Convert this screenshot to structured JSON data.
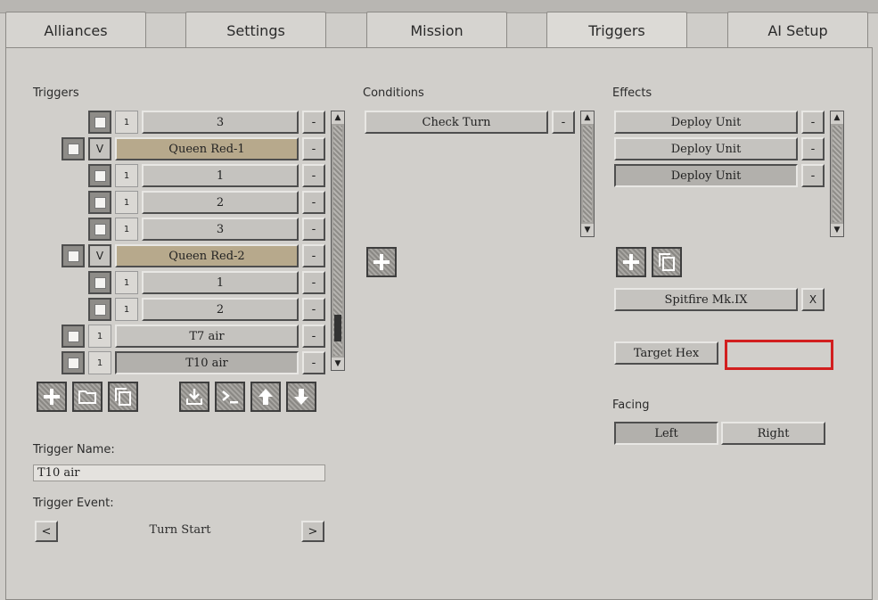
{
  "tabs": [
    "Alliances",
    "Settings",
    "Mission",
    "Triggers",
    "AI Setup"
  ],
  "active_tab": "Triggers",
  "triggers": {
    "heading": "Triggers",
    "rows": [
      {
        "num": "1",
        "label": "3",
        "has_v": false,
        "tan": false
      },
      {
        "num": "V",
        "label": "Queen Red-1",
        "has_v": true,
        "tan": true
      },
      {
        "num": "1",
        "label": "1",
        "has_v": false,
        "tan": false
      },
      {
        "num": "1",
        "label": "2",
        "has_v": false,
        "tan": false
      },
      {
        "num": "1",
        "label": "3",
        "has_v": false,
        "tan": false
      },
      {
        "num": "V",
        "label": "Queen Red-2",
        "has_v": true,
        "tan": true
      },
      {
        "num": "1",
        "label": "1",
        "has_v": false,
        "tan": false
      },
      {
        "num": "1",
        "label": "2",
        "has_v": false,
        "tan": false
      },
      {
        "num": "1",
        "label": "T7 air",
        "has_v": false,
        "tan": false
      },
      {
        "num": "1",
        "label": "T10 air",
        "has_v": false,
        "tan": false
      }
    ],
    "minus_label": "-",
    "toolbar_icons": [
      "add-icon",
      "folder-icon",
      "copy-icon",
      "import-icon",
      "terminal-icon",
      "move-up-icon",
      "move-down-icon"
    ]
  },
  "trigger_name": {
    "label": "Trigger Name:",
    "value": "T10 air"
  },
  "trigger_event": {
    "label": "Trigger Event:",
    "value": "Turn Start",
    "prev": "<",
    "next": ">"
  },
  "conditions": {
    "heading": "Conditions",
    "items": [
      "Check Turn"
    ]
  },
  "effects": {
    "heading": "Effects",
    "items": [
      "Deploy Unit",
      "Deploy Unit",
      "Deploy Unit"
    ],
    "unit": "Spitfire Mk.IX",
    "unit_clear": "X",
    "target_hex_label": "Target Hex",
    "target_hex_value": "",
    "facing_label": "Facing",
    "facing_options": [
      "Left",
      "Right"
    ],
    "facing_selected": "Left"
  },
  "colors": {
    "highlight": "#d21f1f",
    "tan_row": "#b7a98c"
  }
}
